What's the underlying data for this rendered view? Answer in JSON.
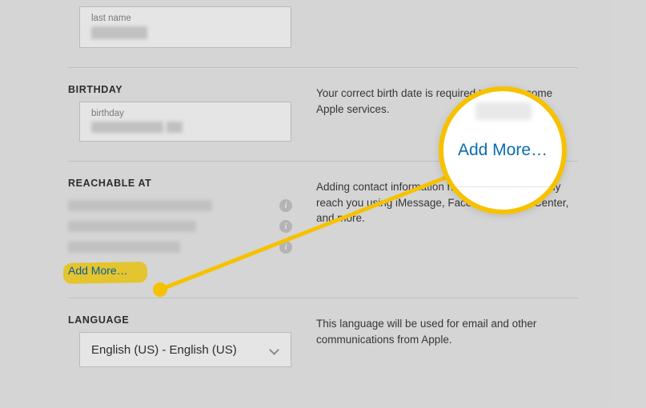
{
  "lastNameSection": {
    "innerLabel": "last name"
  },
  "birthdaySection": {
    "heading": "BIRTHDAY",
    "innerLabel": "birthday",
    "description": "Your correct birth date is required to enable some Apple services."
  },
  "reachableSection": {
    "heading": "REACHABLE AT",
    "description": "Adding contact information helps friends and family reach you using iMessage, FaceTime, Game Center, and more.",
    "addMoreLabel": "Add More…"
  },
  "languageSection": {
    "heading": "LANGUAGE",
    "selected": "English (US) - English (US)",
    "description": "This language will be used for email and other communications from Apple."
  },
  "callout": {
    "text": "Add More…"
  }
}
